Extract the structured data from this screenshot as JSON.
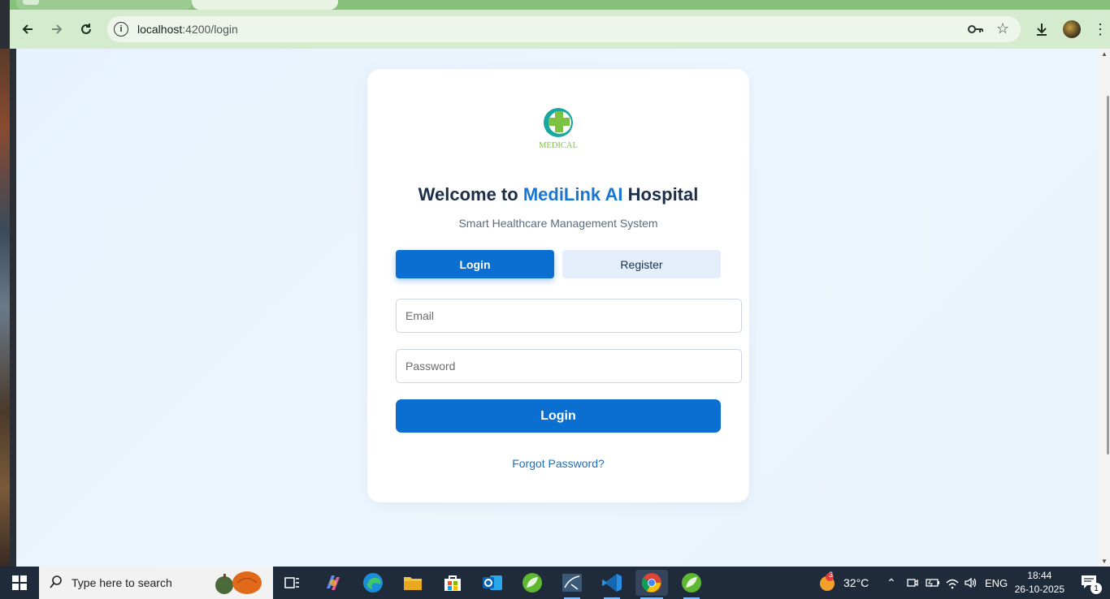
{
  "browser": {
    "url_host": "localhost",
    "url_path": ":4200/login"
  },
  "page": {
    "title_prefix": "Welcome to ",
    "title_brand": "MediLink AI",
    "title_suffix": " Hospital",
    "subtitle": "Smart Healthcare Management System",
    "logo_text": "MEDICAL",
    "tabs": {
      "login": "Login",
      "register": "Register"
    },
    "email_placeholder": "Email",
    "password_placeholder": "Password",
    "submit_label": "Login",
    "forgot_label": "Forgot Password?"
  },
  "taskbar": {
    "search_placeholder": "Type here to search",
    "weather_temp": "32°C",
    "weather_badge": "3",
    "language": "ENG",
    "time": "18:44",
    "date": "26-10-2025",
    "notification_count": "1"
  },
  "colors": {
    "brand_blue": "#0a6fd0",
    "title_dark": "#1d2e4a",
    "chrome_green": "#d4ebcd"
  }
}
